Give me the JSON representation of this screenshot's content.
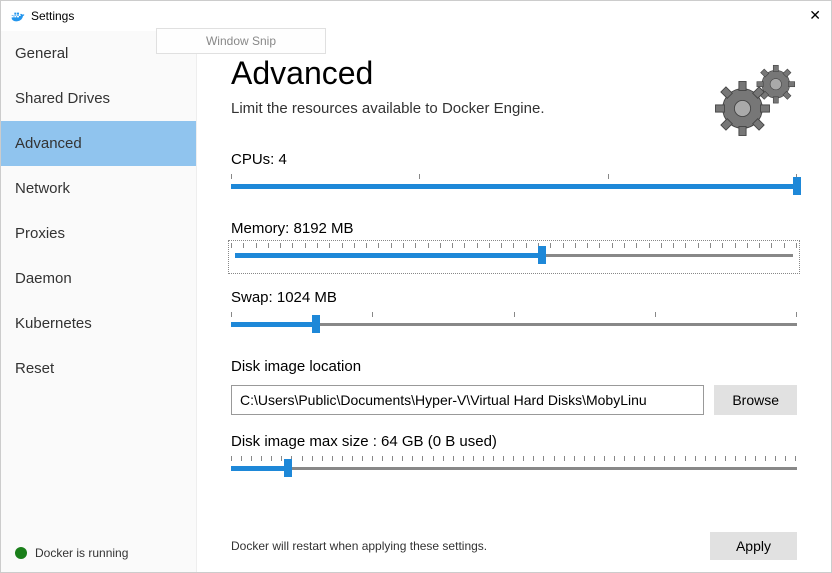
{
  "window": {
    "title": "Settings"
  },
  "snip": {
    "label": "Window Snip"
  },
  "sidebar": {
    "items": [
      {
        "label": "General"
      },
      {
        "label": "Shared Drives"
      },
      {
        "label": "Advanced"
      },
      {
        "label": "Network"
      },
      {
        "label": "Proxies"
      },
      {
        "label": "Daemon"
      },
      {
        "label": "Kubernetes"
      },
      {
        "label": "Reset"
      }
    ],
    "status": "Docker is running"
  },
  "page": {
    "heading": "Advanced",
    "subtitle": "Limit the resources available to Docker Engine.",
    "cpu_label": "CPUs: 4",
    "memory_label": "Memory: 8192 MB",
    "swap_label": "Swap: 1024 MB",
    "disk_loc_label": "Disk image location",
    "disk_loc_value": "C:\\Users\\Public\\Documents\\Hyper-V\\Virtual Hard Disks\\MobyLinu",
    "browse": "Browse",
    "disk_size_label": "Disk image max size : 64 GB (0 B  used)",
    "restart_note": "Docker will restart when applying these settings.",
    "apply": "Apply"
  },
  "sliders": {
    "cpu": {
      "fill": 100,
      "thumb": 100,
      "ticks": 4
    },
    "memory": {
      "fill": 55,
      "thumb": 55,
      "ticks": 47
    },
    "swap": {
      "fill": 15,
      "thumb": 15,
      "ticks": 5
    },
    "disk": {
      "fill": 10,
      "thumb": 10,
      "ticks": 57
    }
  }
}
